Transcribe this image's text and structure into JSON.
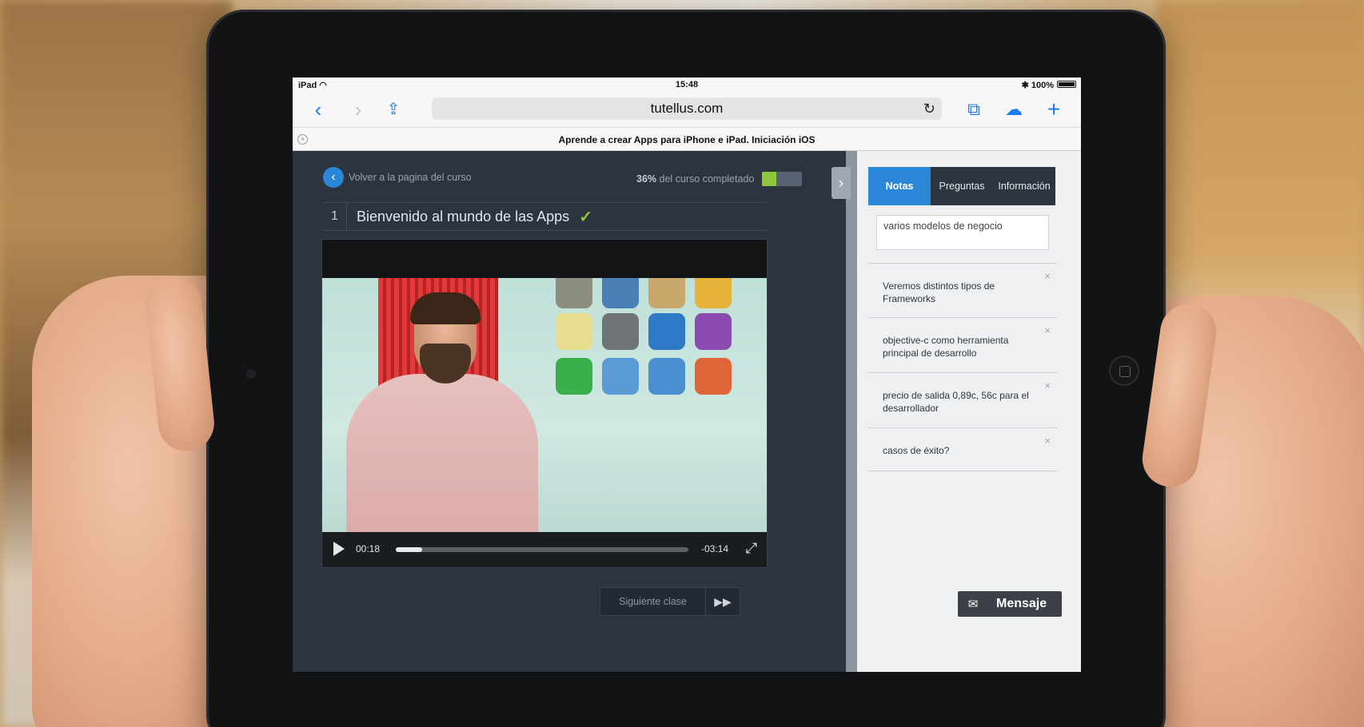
{
  "status_bar": {
    "device": "iPad",
    "time": "15:48",
    "battery": "100%"
  },
  "browser": {
    "url": "tutellus.com",
    "tab_title": "Aprende a crear Apps para iPhone e iPad. Iniciación iOS",
    "icons": [
      "back-icon",
      "forward-icon",
      "share-icon",
      "reload-icon",
      "bookmarks-icon",
      "cloud-icon",
      "new-tab-icon"
    ]
  },
  "course": {
    "back_label": "Volver a la pagina del curso",
    "progress_percent": "36%",
    "progress_suffix": "del curso completado",
    "progress_value": 0.36,
    "lesson_number": "1",
    "lesson_title": "Bienvenido al mundo de las Apps",
    "lesson_complete": true
  },
  "video": {
    "elapsed": "00:18",
    "remaining": "-03:14",
    "played_fraction": 0.09
  },
  "next_button": {
    "label": "Siguiente clase"
  },
  "notes_panel": {
    "tabs": [
      "Notas",
      "Preguntas",
      "Información"
    ],
    "active_tab": "Notas",
    "input_value": "varios modelos de negocio",
    "notes": [
      "Veremos distintos tipos de Frameworks",
      "objective-c como herramienta principal de desarrollo",
      "precio de salida 0,89c, 56c para el desarrollador",
      "casos de éxito?"
    ]
  },
  "message_button": {
    "label": "Mensaje"
  },
  "colors": {
    "accent_blue": "#2a86d6",
    "progress_green": "#8fc63c",
    "dark_panel": "#2c3440"
  }
}
